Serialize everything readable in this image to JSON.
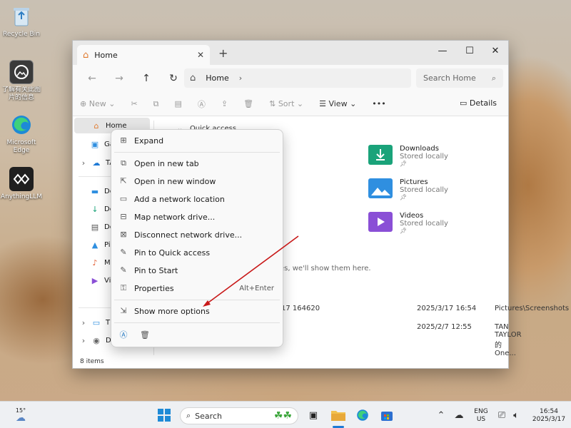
{
  "desktop": {
    "icons": [
      {
        "label": "Recycle Bin",
        "icon": "recycle-bin-icon"
      },
      {
        "label": "了解有关此图片的信息",
        "icon": "learn-picture-icon"
      },
      {
        "label": "Microsoft Edge",
        "icon": "edge-icon"
      },
      {
        "label": "AnythingLLM",
        "icon": "anythingllm-icon"
      }
    ]
  },
  "explorer": {
    "tab_title": "Home",
    "new_tab_glyph": "+",
    "window_controls": {
      "minimize": "—",
      "maximize": "☐",
      "close": "✕"
    },
    "address": {
      "crumb": "Home"
    },
    "search": {
      "placeholder": "Search Home"
    },
    "toolbar": {
      "new": "New",
      "sort": "Sort",
      "view": "View",
      "more": "•••",
      "details": "Details"
    },
    "sidebar": [
      {
        "label": "Home",
        "icon": "home-icon"
      },
      {
        "label": "Ga",
        "icon": "gallery-icon"
      },
      {
        "label": "TA",
        "icon": "onedrive-icon"
      },
      {
        "label": "De",
        "icon": "desktop-icon"
      },
      {
        "label": "Do",
        "icon": "downloads-icon"
      },
      {
        "label": "Do",
        "icon": "documents-icon"
      },
      {
        "label": "Pic",
        "icon": "pictures-icon"
      },
      {
        "label": "Mu",
        "icon": "music-icon"
      },
      {
        "label": "Vic",
        "icon": "videos-icon"
      },
      {
        "label": "Th",
        "icon": "this-pc-icon"
      },
      {
        "label": "DV",
        "icon": "dvd-drive-icon"
      }
    ],
    "quick_access": "Quick access",
    "folders": [
      {
        "name": "Downloads",
        "sub": "Stored locally",
        "color": "#1aa37a"
      },
      {
        "name": "Pictures",
        "sub": "Stored locally",
        "color": "#2f8fe0"
      },
      {
        "name": "Videos",
        "sub": "Stored locally",
        "color": "#8a4fd6"
      }
    ],
    "favorites_hint": "es, we'll show them here.",
    "recent": [
      {
        "name": "17 164620",
        "date": "2025/3/17 16:54",
        "location": "Pictures\\Screenshots"
      },
      {
        "name": "",
        "date": "2025/2/7 12:55",
        "location": "TAN TAYLOR 的 One..."
      }
    ],
    "status": "8 items"
  },
  "context_menu": {
    "items": [
      {
        "label": "Expand",
        "icon": "expand-icon"
      },
      {
        "label": "Open in new tab",
        "icon": "new-tab-icon"
      },
      {
        "label": "Open in new window",
        "icon": "new-window-icon"
      },
      {
        "label": "Add a network location",
        "icon": "network-location-icon"
      },
      {
        "label": "Map network drive...",
        "icon": "map-drive-icon"
      },
      {
        "label": "Disconnect network drive...",
        "icon": "disconnect-drive-icon"
      },
      {
        "label": "Pin to Quick access",
        "icon": "pin-icon"
      },
      {
        "label": "Pin to Start",
        "icon": "pin-start-icon"
      },
      {
        "label": "Properties",
        "icon": "properties-icon",
        "shortcut": "Alt+Enter"
      },
      {
        "label": "Show more options",
        "icon": "more-options-icon"
      }
    ]
  },
  "taskbar": {
    "weather": "15°",
    "search_label": "Search",
    "lang": [
      "ENG",
      "US"
    ],
    "time": "16:54",
    "date": "2025/3/17"
  }
}
